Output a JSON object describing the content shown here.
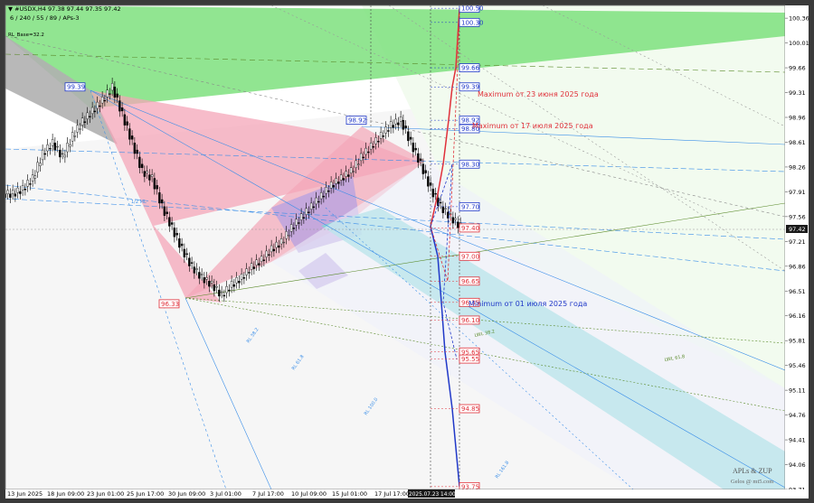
{
  "header": {
    "symbol_line": "▼ #USDX,H4  97.38 97.44 97.35 97.42",
    "params_line": "6 / 240 / 55 / 89 / APs-3",
    "rl_label": "RL_Base=32.2"
  },
  "watermark": {
    "line1": "APLs & ZUP",
    "line2": "Gelos @ mt5.com"
  },
  "current_price": "97.42",
  "current_time_label": "2025.07.23 14:00",
  "annotations": {
    "max_june": "Maximum от 23 июня 2025 года",
    "max_july": "Maximum от 17 июля 2025 года",
    "min_july": "Minimum от 01 июля 2025 года"
  },
  "fan_labels": {
    "lwl382": "LWL 38.2",
    "lwl618": "LWL 61.8",
    "rl382": "RL 38.2",
    "rl618": "RL 61.8",
    "rl1000": "RL 100.0",
    "rl1618": "RL 161.8",
    "swl": "1/2 ML"
  },
  "colors": {
    "bg": "#ffffff",
    "green_zone": "#7ee07e",
    "pink_zone": "#f4a6b8",
    "cyan_zone": "#7fd8d8",
    "violet_zone": "#b9a3e0",
    "bullet_red": "#e0303a",
    "bullet_blue": "#2038c8",
    "fan_blue": "#3a8ee8"
  },
  "chart_data": {
    "type": "candlestick",
    "symbol": "#USDX",
    "timeframe": "H4",
    "ylim": [
      93.71,
      100.54
    ],
    "y_ticks": [
      "100.36",
      "100.01",
      "99.66",
      "99.31",
      "98.96",
      "98.61",
      "98.26",
      "97.91",
      "97.56",
      "97.21",
      "96.86",
      "96.51",
      "96.16",
      "95.81",
      "95.46",
      "95.11",
      "94.76",
      "94.41",
      "94.06",
      "93.71"
    ],
    "x_ticks": [
      "13 Jun 2025",
      "18 Jun 09:00",
      "23 Jun 01:00",
      "25 Jun 17:00",
      "30 Jun 09:00",
      "3 Jul 01:00",
      "7 Jul 17:00",
      "10 Jul 09:00",
      "15 Jul 01:00",
      "17 Jul 17:00"
    ],
    "close_path": [
      97.88,
      97.95,
      98.1,
      98.45,
      98.6,
      98.4,
      98.7,
      98.9,
      99.05,
      99.2,
      99.39,
      99.0,
      98.6,
      98.2,
      98.1,
      97.7,
      97.4,
      97.1,
      96.85,
      96.7,
      96.6,
      96.45,
      96.6,
      96.7,
      96.85,
      96.95,
      97.1,
      97.2,
      97.4,
      97.55,
      97.7,
      97.85,
      98.0,
      98.1,
      98.2,
      98.4,
      98.55,
      98.7,
      98.85,
      98.92,
      98.6,
      98.3,
      97.95,
      97.7,
      97.55,
      97.42
    ],
    "swing_labels": [
      {
        "label": "99.39",
        "kind": "high"
      },
      {
        "label": "98.92",
        "kind": "high"
      },
      {
        "label": "96.33",
        "kind": "low"
      }
    ],
    "target_levels_blue": [
      "100.50",
      "100.30",
      "99.66",
      "99.39",
      "98.92",
      "98.80",
      "98.30",
      "97.70"
    ],
    "target_levels_red": [
      "97.40",
      "97.00",
      "96.65",
      "96.35",
      "96.10",
      "95.65",
      "95.55",
      "94.85",
      "93.75"
    ]
  }
}
